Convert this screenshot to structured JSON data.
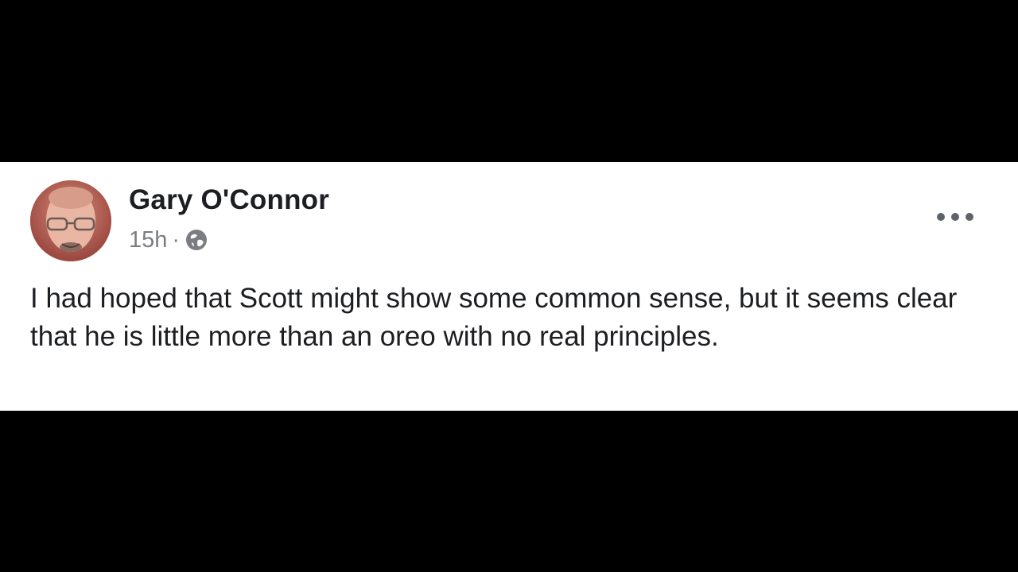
{
  "post": {
    "author": "Gary O'Connor",
    "timestamp": "15h",
    "separator": "·",
    "privacy_icon": "globe-icon",
    "menu_icon": "more-options-icon",
    "text": "I had hoped that Scott might show some common sense, but it seems clear that he is little more than an oreo with no real principles."
  },
  "colors": {
    "background": "#000000",
    "card": "#ffffff",
    "text": "#1c1e21",
    "meta": "#7a7d82"
  }
}
